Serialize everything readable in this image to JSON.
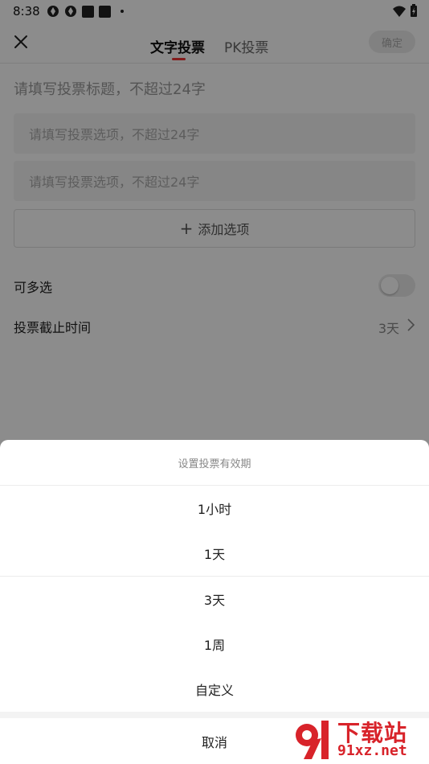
{
  "status_bar": {
    "time": "8:38"
  },
  "header": {
    "tabs": [
      {
        "label": "文字投票",
        "active": true
      },
      {
        "label": "PK投票",
        "active": false
      }
    ],
    "confirm_label": "确定"
  },
  "form": {
    "title_placeholder": "请填写投票标题，不超过24字",
    "option_placeholders": [
      "请填写投票选项，不超过24字",
      "请填写投票选项，不超过24字"
    ],
    "add_option_label": "添加选项",
    "multi_select_label": "可多选",
    "multi_select_on": false,
    "deadline_label": "投票截止时间",
    "deadline_value": "3天"
  },
  "sheet": {
    "title": "设置投票有效期",
    "options": [
      "1小时",
      "1天",
      "3天",
      "1周",
      "自定义"
    ],
    "cancel_label": "取消"
  },
  "watermark": {
    "text_cn": "下载站",
    "text_url": "91xz.net"
  },
  "colors": {
    "accent": "#e33333",
    "watermark": "#d8232a"
  }
}
